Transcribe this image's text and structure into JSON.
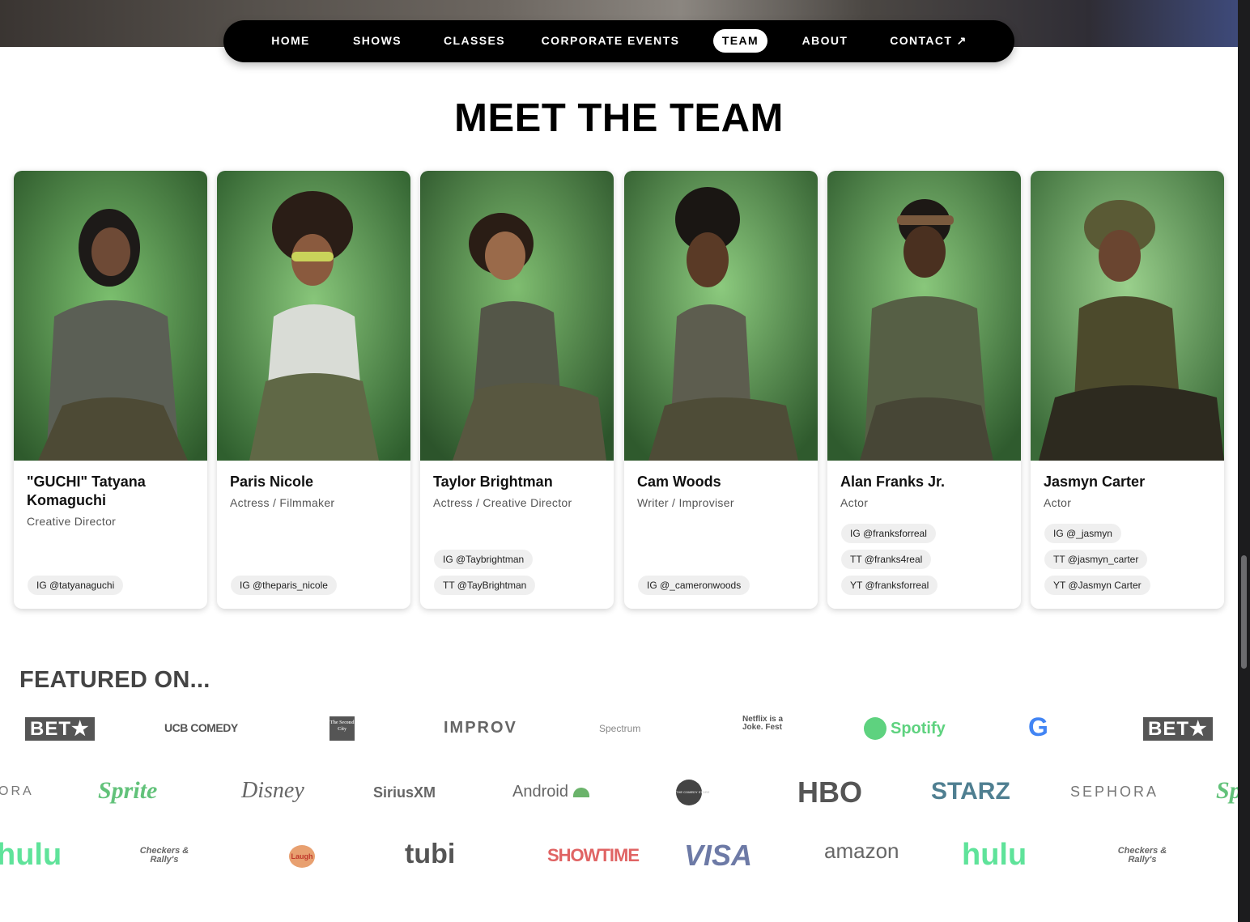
{
  "nav": {
    "items": [
      {
        "label": "HOME"
      },
      {
        "label": "SHOWS"
      },
      {
        "label": "CLASSES"
      },
      {
        "label": "CORPORATE EVENTS"
      },
      {
        "label": "TEAM",
        "active": true
      },
      {
        "label": "ABOUT"
      },
      {
        "label": "CONTACT ↗"
      }
    ]
  },
  "section_title": "MEET THE TEAM",
  "team": [
    {
      "name": "\"GUCHI\" Tatyana Komaguchi",
      "role": "Creative Director",
      "socials": [
        "IG @tatyanaguchi"
      ]
    },
    {
      "name": "Paris Nicole",
      "role": "Actress / Filmmaker",
      "socials": [
        "IG @theparis_nicole"
      ]
    },
    {
      "name": "Taylor Brightman",
      "role": "Actress / Creative Director",
      "socials": [
        "IG @Taybrightman",
        "TT @TayBrightman"
      ]
    },
    {
      "name": "Cam Woods",
      "role": "Writer / Improviser",
      "socials": [
        "IG @_cameronwoods"
      ]
    },
    {
      "name": "Alan Franks Jr.",
      "role": "Actor",
      "socials": [
        "IG @franksforreal",
        "TT @franks4real",
        "YT @franksforreal"
      ]
    },
    {
      "name": "Jasmyn Carter",
      "role": "Actor",
      "socials": [
        "IG @_jasmyn",
        "TT @jasmyn_carter",
        "YT @Jasmyn Carter"
      ]
    }
  ],
  "featured_title": "FEATURED ON...",
  "logos_row1": [
    "BET★",
    "UCB COMEDY",
    "The Second City",
    "IMPROV",
    "Spectrum",
    "Netflix is a Joke. Fest",
    "Spotify",
    "G",
    "BET★"
  ],
  "logos_row2": [
    "ORA",
    "Sprite",
    "Disney",
    "SiriusXM",
    "Android",
    "THE COMEDY STORE",
    "HBO",
    "STARZ",
    "SEPHORA",
    "Sp"
  ],
  "logos_row3": [
    "hulu",
    "Checkers & Rally's",
    "Laugh",
    "tubi",
    "SHOWTIME",
    "VISA",
    "amazon",
    "hulu",
    "Checkers & Rally's"
  ],
  "colors": {
    "nav_bg": "#000000",
    "photo_green": "#5a9a52",
    "spotify": "#1ed760",
    "hulu": "#1ce783",
    "starz": "#2f6f85"
  }
}
